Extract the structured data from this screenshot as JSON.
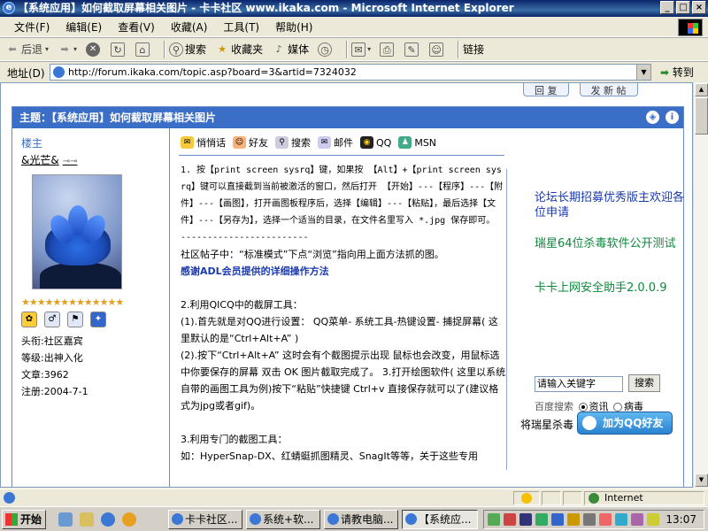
{
  "window": {
    "title": "【系统应用】如何截取屏幕相关图片 - 卡卡社区 www.ikaka.com - Microsoft Internet Explorer",
    "min": "_",
    "max": "□",
    "close": "×"
  },
  "menu": [
    "文件(F)",
    "编辑(E)",
    "查看(V)",
    "收藏(A)",
    "工具(T)",
    "帮助(H)"
  ],
  "toolbar": {
    "back": "后退",
    "search": "搜索",
    "favorites": "收藏夹",
    "media": "媒体",
    "links": "链接"
  },
  "address": {
    "label": "地址(D)",
    "url": "http://forum.ikaka.com/topic.asp?board=3&artid=7324032",
    "go": "转到"
  },
  "page": {
    "top_buttons": [
      "回 复",
      "发 新 帖"
    ],
    "post_title": "主题：【系统应用】如何截取屏幕相关图片",
    "author": {
      "role": "楼主",
      "name": "&光芒&",
      "stars": "★★★★★★★★★★★★★",
      "info": [
        "头衔:社区嘉宾",
        "等级:出神入化",
        "文章:3962",
        "注册:2004-7-1"
      ]
    },
    "actions": [
      "悄悄话",
      "好友",
      "搜索",
      "邮件",
      "QQ",
      "MSN"
    ],
    "body": {
      "p1": "1. 按【print screen sysrq】键，如果按 【Alt】+【print screen sysrq】键可以直接截到当前被激活的窗口，然后打开 【开始】---【程序】---【附件】---【画图】，打开画图板程序后，选择【编辑】---【粘贴】，最后选择【文件】---【另存为】，选择一个适当的目录，在文件名里写入 *.jpg 保存即可。",
      "divider": "------------------------",
      "p2": "社区帖子中：“标准模式”下点“浏览”指向用上面方法抓的图。",
      "p2_thanks": "感谢ADL会员提供的详细操作方法",
      "p3_title": "2.利用QICQ中的截屏工具：",
      "p3_a": "(1).首先就是对QQ进行设置： QQ菜单- 系统工具-热键设置- 捕捉屏幕( 这里默认的是“Ctrl+Alt+A” )",
      "p3_b": "(2).按下“Ctrl+Alt+A” 这时会有个截图提示出现 鼠标也会改变，用鼠标选中你要保存的屏幕 双击 OK 图片截取完成了。 3.打开绘图软件( 这里以系统自带的画图工具为例)按下“粘贴”快捷键 Ctrl+v 直接保存就可以了(建议格式为jpg或者gif)。",
      "p4_title": "3.利用专门的截图工具：",
      "p4_a": "如：HyperSnap-DX、红蜻蜓抓图精灵、SnagIt等等，关于这些专用"
    },
    "ads": {
      "a1": "论坛长期招募优秀版主欢迎各位申请",
      "a2": "瑞星64位杀毒软件公开测试",
      "a3": "卡卡上网安全助手2.0.0.9"
    },
    "search": {
      "input": "请输入关键字",
      "button": "搜索",
      "label": "百度搜索",
      "opt1": "资讯",
      "opt2": "病毒"
    },
    "qq": {
      "text": "将瑞星杀毒",
      "button": "加为QQ好友"
    }
  },
  "status": {
    "zone": "Internet"
  },
  "taskbar": {
    "start": "开始",
    "tasks": [
      "卡卡社区...",
      "系统+软...",
      "请教电脑...",
      "【系统应..."
    ],
    "clock": "13:07"
  },
  "colors": {
    "titlebar": "#0a246a",
    "post_header": "#3a6ec7",
    "ad_green": "#0a8a3a",
    "ad_blue": "#1a3ab0"
  }
}
